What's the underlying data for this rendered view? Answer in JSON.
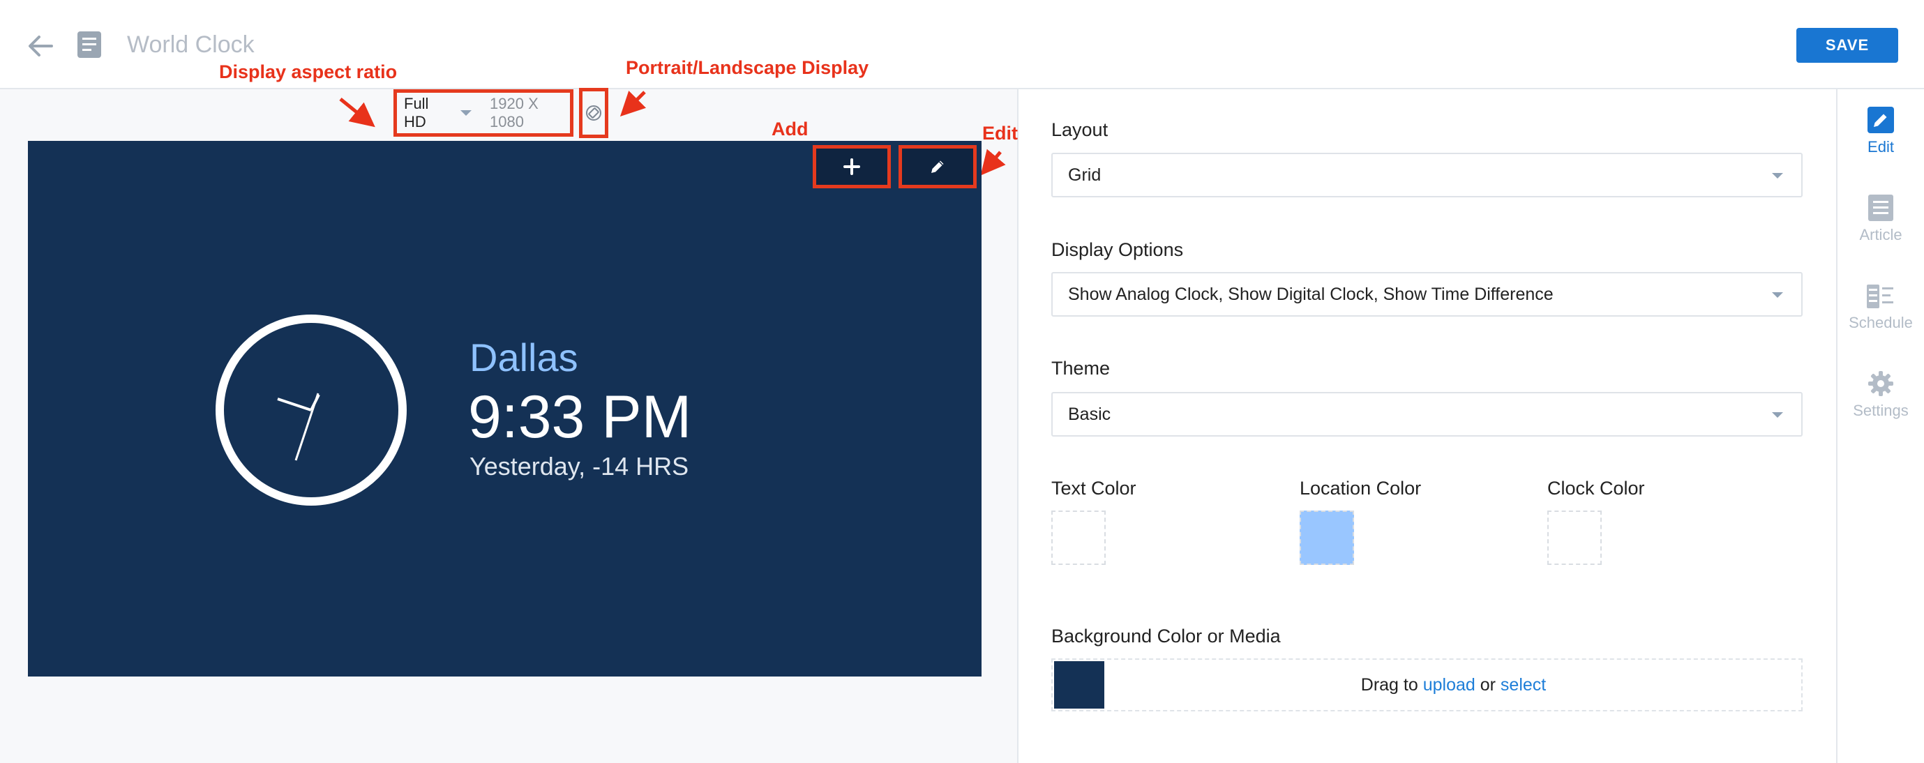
{
  "header": {
    "title": "World Clock",
    "save_label": "SAVE"
  },
  "preview": {
    "resolution": {
      "preset": "Full HD",
      "dimensions": "1920 X 1080"
    },
    "clock": {
      "city": "Dallas",
      "time": "9:33 PM",
      "day_offset": "Yesterday, -14 HRS"
    },
    "background_color": "#143155",
    "location_color": "#8fc2ff"
  },
  "annotations": {
    "aspect_ratio": "Display aspect ratio",
    "orientation": "Portrait/Landscape Display",
    "add": "Add",
    "edit": "Edit"
  },
  "settings": {
    "layout": {
      "label": "Layout",
      "value": "Grid"
    },
    "display_options": {
      "label": "Display Options",
      "value": "Show Analog Clock, Show Digital Clock, Show Time Difference"
    },
    "theme": {
      "label": "Theme",
      "value": "Basic"
    },
    "text_color": {
      "label": "Text Color"
    },
    "location_color": {
      "label": "Location Color",
      "color": "#99c6ff"
    },
    "clock_color": {
      "label": "Clock Color"
    },
    "background": {
      "label": "Background Color or Media",
      "drop_prefix": "Drag to",
      "upload_label": "upload",
      "or_label": "or",
      "select_label": "select",
      "swatch_color": "#143155"
    }
  },
  "rail": [
    {
      "label": "Edit",
      "icon": "pencil-icon",
      "active": true
    },
    {
      "label": "Article",
      "icon": "article-icon",
      "active": false
    },
    {
      "label": "Schedule",
      "icon": "schedule-icon",
      "active": false
    },
    {
      "label": "Settings",
      "icon": "gear-icon",
      "active": false
    }
  ],
  "colors": {
    "accent": "#1976d2",
    "annotation": "#e8321b"
  }
}
